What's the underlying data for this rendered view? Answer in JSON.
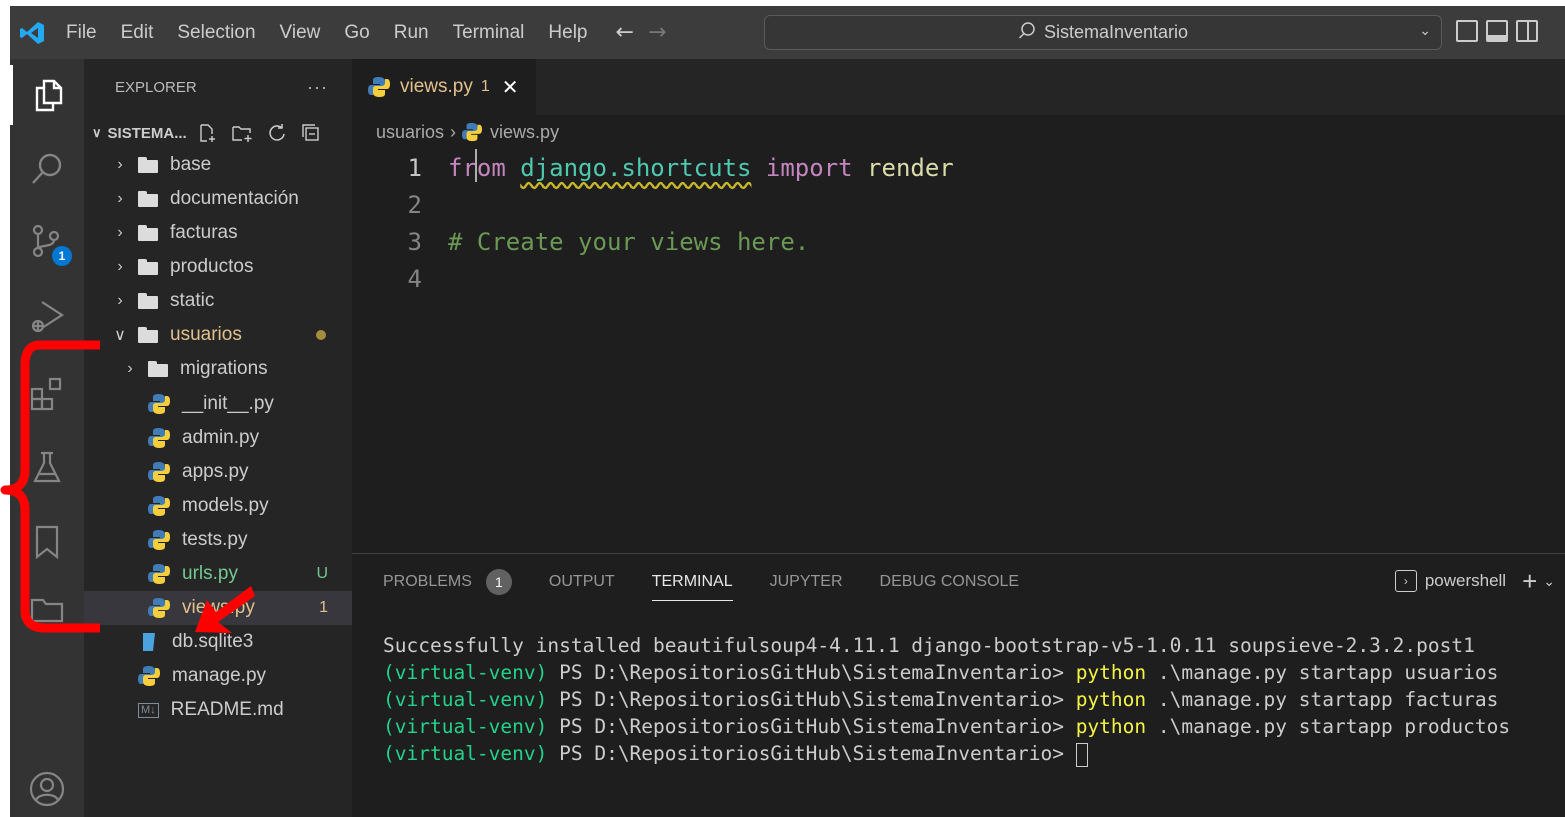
{
  "titlebar": {
    "menu": [
      "File",
      "Edit",
      "Selection",
      "View",
      "Go",
      "Run",
      "Terminal",
      "Help"
    ],
    "search_text": "SistemaInventario",
    "icons": [
      "vscode-logo-icon",
      "back-arrow-icon",
      "forward-arrow-icon",
      "search-icon",
      "layout-icons"
    ]
  },
  "activity_bar": {
    "items": [
      "explorer-icon",
      "search-icon",
      "source-control-icon",
      "run-debug-icon",
      "extensions-icon",
      "testing-icon",
      "bookmarks-icon",
      "remote-explorer-icon",
      "account-icon"
    ],
    "source_control_badge": "1"
  },
  "sidebar": {
    "title": "EXPLORER",
    "more": "···",
    "root": "SISTEMA...",
    "tree": [
      {
        "label": "base",
        "type": "folder",
        "state": "collapsed"
      },
      {
        "label": "documentación",
        "type": "folder",
        "state": "collapsed"
      },
      {
        "label": "facturas",
        "type": "folder",
        "state": "collapsed"
      },
      {
        "label": "productos",
        "type": "folder",
        "state": "collapsed"
      },
      {
        "label": "static",
        "type": "folder",
        "state": "collapsed"
      },
      {
        "label": "usuarios",
        "type": "folder",
        "state": "expanded"
      },
      {
        "label": "migrations",
        "type": "folder",
        "state": "collapsed"
      },
      {
        "label": "__init__.py",
        "type": "python"
      },
      {
        "label": "admin.py",
        "type": "python"
      },
      {
        "label": "apps.py",
        "type": "python"
      },
      {
        "label": "models.py",
        "type": "python"
      },
      {
        "label": "tests.py",
        "type": "python"
      },
      {
        "label": "urls.py",
        "type": "python",
        "badge": "U"
      },
      {
        "label": "views.py",
        "type": "python",
        "badge": "1"
      },
      {
        "label": "db.sqlite3",
        "type": "sqlite"
      },
      {
        "label": "manage.py",
        "type": "python"
      },
      {
        "label": "README.md",
        "type": "markdown",
        "icon_text": "M↓"
      }
    ]
  },
  "editor": {
    "tab": {
      "label": "views.py",
      "problems": "1",
      "close": "✕"
    },
    "breadcrumb": {
      "folder": "usuarios",
      "sep": "›",
      "file": "views.py"
    },
    "line_numbers": [
      "1",
      "2",
      "3",
      "4"
    ],
    "code": {
      "from": "from",
      "module": "django.shortcuts",
      "import": "import",
      "name": "render",
      "comment": "# Create your views here."
    }
  },
  "panel": {
    "tabs": [
      "PROBLEMS",
      "OUTPUT",
      "TERMINAL",
      "JUPYTER",
      "DEBUG CONSOLE"
    ],
    "problems_count": "1",
    "active_tab": "TERMINAL",
    "shell": "powershell",
    "terminal": {
      "line0": "Successfully installed beautifulsoup4-4.11.1 django-bootstrap-v5-1.0.11 soupsieve-2.3.2.post1",
      "venv": "(virtual-venv)",
      "prompt": " PS D:\\RepositoriosGitHub\\SistemaInventario> ",
      "py": "python",
      "cmd1": " .\\manage.py startapp usuarios",
      "cmd2": " .\\manage.py startapp facturas",
      "cmd3": " .\\manage.py startapp productos"
    }
  },
  "colors": {
    "titlebar": "#3c3c3c",
    "activity_bar": "#333333",
    "sidebar": "#252526",
    "editor": "#1e1e1e",
    "annotation": "#ff0000",
    "git_modified": "#e2c08d",
    "venv_green": "#23d18b",
    "python_yellow": "#f5f543"
  }
}
